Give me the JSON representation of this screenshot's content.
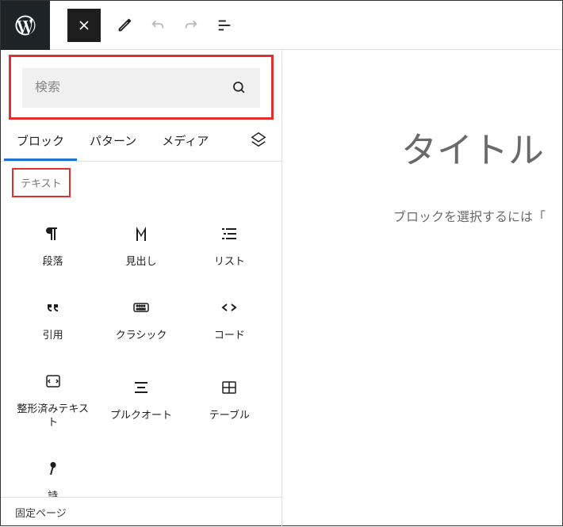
{
  "search": {
    "placeholder": "検索"
  },
  "tabs": {
    "blocks": "ブロック",
    "patterns": "パターン",
    "media": "メディア"
  },
  "category": {
    "text": "テキスト"
  },
  "blocks": {
    "paragraph": "段落",
    "heading": "見出し",
    "list": "リスト",
    "quote": "引用",
    "classic": "クラシック",
    "code": "コード",
    "preformatted": "整形済みテキスト",
    "pullquote": "プルクオート",
    "table": "テーブル",
    "verse": "詩"
  },
  "bottom": {
    "label": "固定ページ"
  },
  "content": {
    "title_placeholder": "タイトル",
    "hint": "ブロックを選択するには「"
  }
}
